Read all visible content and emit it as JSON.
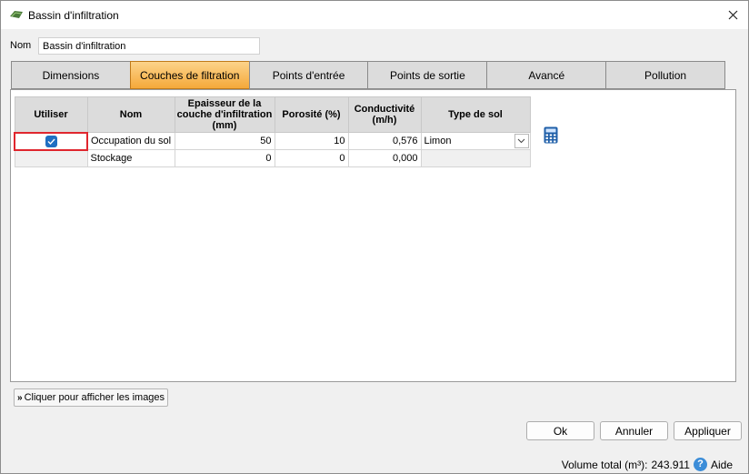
{
  "window": {
    "title": "Bassin d'infiltration"
  },
  "form": {
    "nom_label": "Nom",
    "nom_value": "Bassin d'infiltration"
  },
  "tabs": [
    {
      "label": "Dimensions",
      "active": false
    },
    {
      "label": "Couches de filtration",
      "active": true
    },
    {
      "label": "Points d'entrée",
      "active": false
    },
    {
      "label": "Points de sortie",
      "active": false
    },
    {
      "label": "Avancé",
      "active": false
    },
    {
      "label": "Pollution",
      "active": false
    }
  ],
  "table": {
    "headers": {
      "utiliser": "Utiliser",
      "nom": "Nom",
      "epaisseur_l1": "Epaisseur de la",
      "epaisseur_l2": "couche d'infiltration",
      "epaisseur_l3": "(mm)",
      "porosite": "Porosité (%)",
      "conductivite_l1": "Conductivité",
      "conductivite_l2": "(m/h)",
      "type_sol": "Type de sol"
    },
    "rows": [
      {
        "checked": true,
        "nom": "Occupation du sol",
        "epaisseur": "50",
        "porosite": "10",
        "conductivite": "0,576",
        "type_sol": "Limon"
      },
      {
        "checked": false,
        "nom": "Stockage",
        "epaisseur": "0",
        "porosite": "0",
        "conductivite": "0,000",
        "type_sol": ""
      }
    ]
  },
  "images_button": {
    "label": "Cliquer pour afficher les images"
  },
  "buttons": {
    "ok": "Ok",
    "annuler": "Annuler",
    "appliquer": "Appliquer"
  },
  "status": {
    "volume_label": "Volume total (m³):",
    "volume_value": "243.911",
    "help_label": "Aide"
  },
  "icons": [
    "app-icon",
    "close-icon",
    "checkbox-check-icon",
    "chevron-down-icon",
    "calculator-icon",
    "double-chevron-down-icon",
    "help-icon"
  ],
  "colors": {
    "active_tab": "#f5a93a",
    "checkbox": "#1f6fc2",
    "selected_cell_border": "#e0262e",
    "help_icon": "#3c8dd8"
  }
}
